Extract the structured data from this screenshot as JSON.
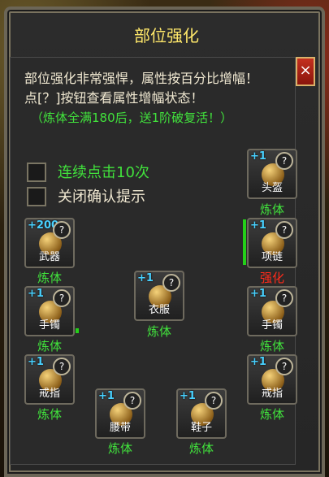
{
  "window": {
    "title": "部位强化",
    "close_label": "×"
  },
  "description": {
    "line1": "部位强化非常强悍，属性按百分比增幅！",
    "line2": "点[？]按钮查看属性增幅状态！",
    "line3": "（炼体全满180后，送1阶破复活！）"
  },
  "options": [
    {
      "label": "连续点击10次",
      "checked": false
    },
    {
      "label": "关闭确认提示",
      "checked": false
    }
  ],
  "slots": {
    "helmet": {
      "name": "头盔",
      "level": "+1",
      "status": "炼体"
    },
    "weapon": {
      "name": "武器",
      "level": "+200",
      "status": "炼体"
    },
    "necklace": {
      "name": "项链",
      "level": "+1",
      "status": "强化"
    },
    "armor": {
      "name": "衣服",
      "level": "+1",
      "status": "炼体"
    },
    "bracelet_left": {
      "name": "手镯",
      "level": "+1",
      "status": "炼体"
    },
    "bracelet_right": {
      "name": "手镯",
      "level": "+1",
      "status": "炼体"
    },
    "ring_left": {
      "name": "戒指",
      "level": "+1",
      "status": "炼体"
    },
    "ring_right": {
      "name": "戒指",
      "level": "+1",
      "status": "炼体"
    },
    "belt": {
      "name": "腰带",
      "level": "+1",
      "status": "炼体"
    },
    "shoes": {
      "name": "鞋子",
      "level": "+1",
      "status": "炼体"
    }
  },
  "help_symbol": "?",
  "colors": {
    "title": "#ffe86a",
    "green": "#41e23c",
    "red": "#ff2b1b",
    "level": "#48d1ff"
  }
}
